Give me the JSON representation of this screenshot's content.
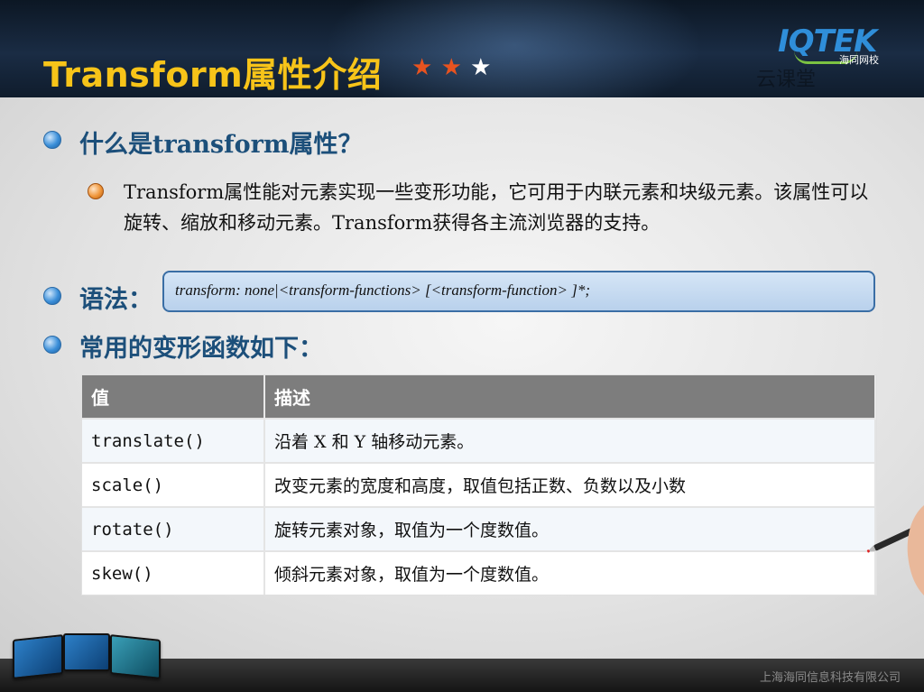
{
  "header": {
    "title": "Transform属性介绍",
    "stars": [
      "★",
      "★",
      "★"
    ],
    "star_colors": [
      "#e8531f",
      "#e8531f",
      "#ffffff"
    ],
    "logo_text": "IQTEK",
    "logo_sub": "海同网校",
    "watermark": "云课堂",
    "title_color": "#f7c419"
  },
  "section1": {
    "heading": "什么是transform属性？",
    "description": "Transform属性能对元素实现一些变形功能，它可用于内联元素和块级元素。该属性可以旋转、缩放和移动元素。Transform获得各主流浏览器的支持。"
  },
  "section2": {
    "heading": "语法：",
    "syntax": "transform: none|<transform-functions> [<transform-function> ]*;"
  },
  "section3": {
    "heading": "常用的变形函数如下："
  },
  "table": {
    "headers": [
      "值",
      "描述"
    ],
    "rows": [
      {
        "value": "translate()",
        "desc": "沿着 X 和 Y 轴移动元素。"
      },
      {
        "value": "scale()",
        "desc": "改变元素的宽度和高度，取值包括正数、负数以及小数"
      },
      {
        "value": "rotate()",
        "desc": "旋转元素对象，取值为一个度数值。"
      },
      {
        "value": "skew()",
        "desc": "倾斜元素对象，取值为一个度数值。"
      }
    ]
  },
  "footer": {
    "company": "上海海同信息科技有限公司"
  },
  "colors": {
    "heading": "#1c4f7a",
    "table_header_bg": "#7d7d7d",
    "syntax_border": "#3a6ea5"
  }
}
